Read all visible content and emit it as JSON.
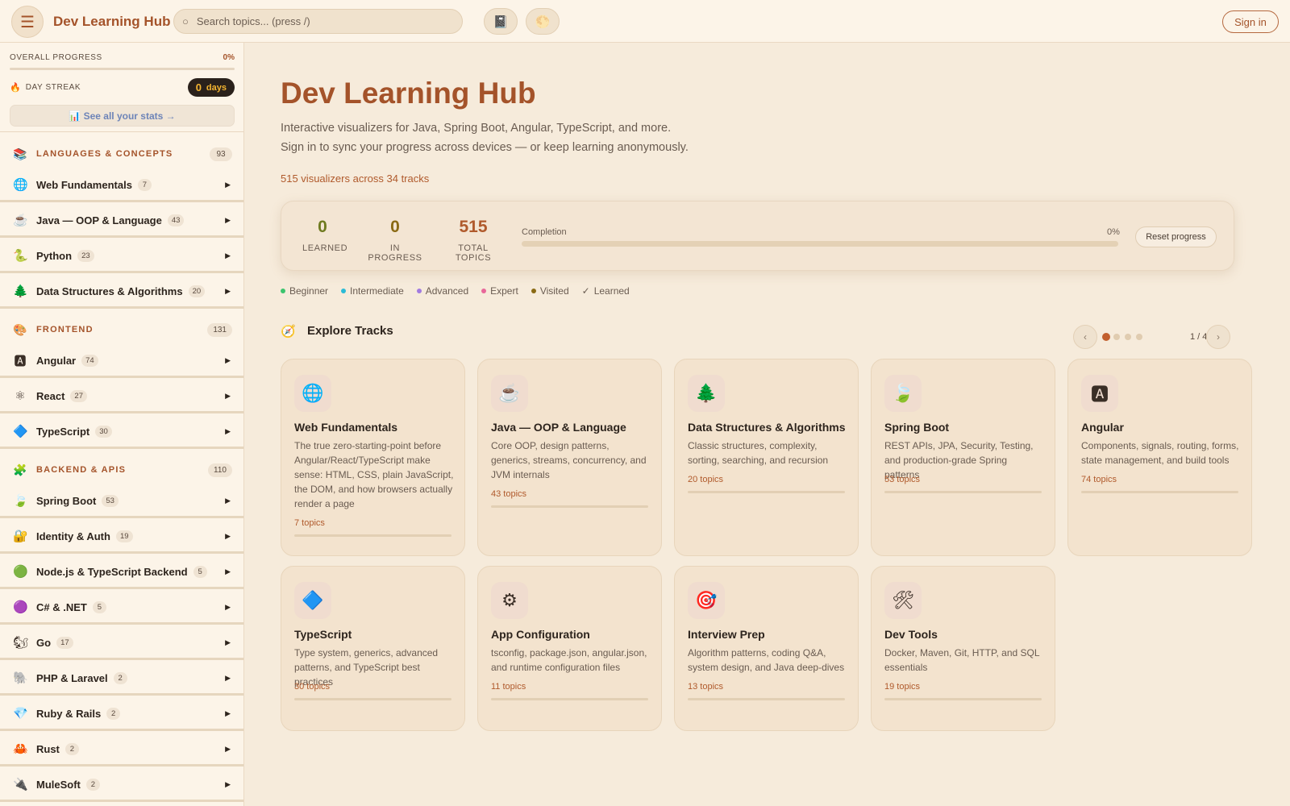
{
  "header": {
    "brand": "Dev Learning Hub",
    "search_placeholder": "Search topics... (press /)",
    "signin_label": "Sign in",
    "icons": {
      "menu": "hamburger-icon",
      "book": "book-icon",
      "theme": "sun-icon"
    }
  },
  "sidebar": {
    "overall_progress_label": "OVERALL PROGRESS",
    "overall_progress_pct": "0%",
    "streak_label": "DAY STREAK",
    "streak_value": "0",
    "streak_unit": "days",
    "stats_link": "📊 See all your stats →",
    "categories": [
      {
        "icon": "📚",
        "label": "LANGUAGES & CONCEPTS",
        "count": "93",
        "items": [
          {
            "icon": "🌐",
            "label": "Web Fundamentals",
            "count": "7"
          },
          {
            "icon": "☕",
            "label": "Java — OOP & Language",
            "count": "43"
          },
          {
            "icon": "🐍",
            "label": "Python",
            "count": "23"
          },
          {
            "icon": "🌲",
            "label": "Data Structures & Algorithms",
            "count": "20"
          }
        ]
      },
      {
        "icon": "🎨",
        "label": "FRONTEND",
        "count": "131",
        "items": [
          {
            "icon": "🅰",
            "label": "Angular",
            "count": "74"
          },
          {
            "icon": "⚛",
            "label": "React",
            "count": "27"
          },
          {
            "icon": "🔷",
            "label": "TypeScript",
            "count": "30"
          }
        ]
      },
      {
        "icon": "🧩",
        "label": "BACKEND & APIS",
        "count": "110",
        "items": [
          {
            "icon": "🍃",
            "label": "Spring Boot",
            "count": "53"
          },
          {
            "icon": "🔐",
            "label": "Identity & Auth",
            "count": "19"
          },
          {
            "icon": "🟢",
            "label": "Node.js & TypeScript Backend",
            "count": "5"
          },
          {
            "icon": "🟣",
            "label": "C# & .NET",
            "count": "5"
          },
          {
            "icon": "🐿",
            "label": "Go",
            "count": "17"
          },
          {
            "icon": "🐘",
            "label": "PHP & Laravel",
            "count": "2"
          },
          {
            "icon": "💎",
            "label": "Ruby & Rails",
            "count": "2"
          },
          {
            "icon": "🦀",
            "label": "Rust",
            "count": "2"
          },
          {
            "icon": "🔌",
            "label": "MuleSoft",
            "count": "2"
          }
        ]
      }
    ]
  },
  "main": {
    "title": "Dev Learning Hub",
    "subtitle_line1": "Interactive visualizers for Java, Spring Boot, Angular, TypeScript, and more.",
    "subtitle_line2": "Sign in to sync your progress across devices — or keep learning anonymously.",
    "track_count": "515 visualizers across 34 tracks",
    "stats": {
      "learned": {
        "value": "0",
        "label": "LEARNED",
        "color": "#6e7a1f"
      },
      "in_progress": {
        "value": "0",
        "label": "IN PROGRESS",
        "color": "#8a6a14"
      },
      "total": {
        "value": "515",
        "label": "TOTAL TOPICS",
        "color": "#b05a2c"
      },
      "completion_label": "Completion",
      "completion_pct": "0%",
      "completion_fraction": 0,
      "reset_label": "Reset progress"
    },
    "legend": [
      {
        "label": "Beginner",
        "color": "#3cc46e",
        "symbol": "dot"
      },
      {
        "label": "Intermediate",
        "color": "#2bbbd6",
        "symbol": "dot"
      },
      {
        "label": "Advanced",
        "color": "#a27be0",
        "symbol": "dot"
      },
      {
        "label": "Expert",
        "color": "#e8689a",
        "symbol": "dot"
      },
      {
        "label": "Visited",
        "color": "#8a6a14",
        "symbol": "dot"
      },
      {
        "label": "Learned",
        "color": "#6a5c51",
        "symbol": "✓"
      }
    ],
    "explore_icon": "🧭",
    "explore_title": "Explore Tracks",
    "pager": {
      "prev": "‹",
      "next": "›",
      "text": "1 / 4",
      "pages": 4,
      "active": 0
    },
    "cards": [
      {
        "icon": "🌐",
        "title": "Web Fundamentals",
        "desc": "The true zero-starting-point before Angular/React/TypeScript make sense: HTML, CSS, plain JavaScript, the DOM, and how browsers actually render a page",
        "topics": "7 topics"
      },
      {
        "icon": "☕",
        "title": "Java — OOP & Language",
        "desc": "Core OOP, design patterns, generics, streams, concurrency, and JVM internals",
        "topics": "43 topics"
      },
      {
        "icon": "🌲",
        "title": "Data Structures & Algorithms",
        "desc": "Classic structures, complexity, sorting, searching, and recursion",
        "topics": "20 topics"
      },
      {
        "icon": "🍃",
        "title": "Spring Boot",
        "desc": "REST APIs, JPA, Security, Testing, and production-grade Spring patterns",
        "topics": "53 topics"
      },
      {
        "icon": "🅰",
        "title": "Angular",
        "desc": "Components, signals, routing, forms, state management, and build tools",
        "topics": "74 topics"
      },
      {
        "icon": "🔷",
        "title": "TypeScript",
        "desc": "Type system, generics, advanced patterns, and TypeScript best practices",
        "topics": "30 topics"
      },
      {
        "icon": "⚙",
        "title": "App Configuration",
        "desc": "tsconfig, package.json, angular.json, and runtime configuration files",
        "topics": "11 topics"
      },
      {
        "icon": "🎯",
        "title": "Interview Prep",
        "desc": "Algorithm patterns, coding Q&A, system design, and Java deep-dives",
        "topics": "13 topics"
      },
      {
        "icon": "🛠",
        "title": "Dev Tools",
        "desc": "Docker, Maven, Git, HTTP, and SQL essentials",
        "topics": "19 topics"
      }
    ]
  }
}
